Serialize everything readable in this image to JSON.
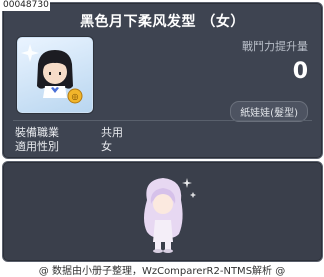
{
  "item_id": "00048730",
  "title": "黑色月下柔风发型 （女）",
  "boost": {
    "label": "戰鬥力提升量",
    "value": "0"
  },
  "category": "紙娃娃(髮型)",
  "attributes": [
    {
      "key": "裝備職業",
      "value": "共用"
    },
    {
      "key": "適用性別",
      "value": "女"
    }
  ],
  "footer": "@ 数据由小册子整理，WzComparerR2-NTMS解析 @",
  "colors": {
    "panel_bg": "#3e4451",
    "text": "#ffffff",
    "icon_bg": "#b9d6f0"
  }
}
